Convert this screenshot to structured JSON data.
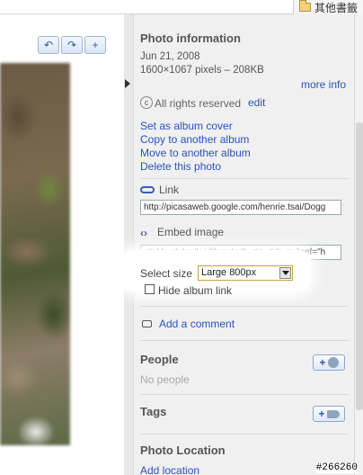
{
  "browser": {
    "bookmark_folder": "其他書籤"
  },
  "toolbar": {
    "rotate_left": "↶",
    "rotate_right": "↷",
    "zoom": "+"
  },
  "photo_info": {
    "title": "Photo information",
    "date": "Jun 21, 2008",
    "dimensions": "1600×1067 pixels – 208KB",
    "more_info": "more info",
    "rights": "All rights reserved",
    "edit": "edit"
  },
  "actions": {
    "set_cover": "Set as album cover",
    "copy": "Copy to another album",
    "move": "Move to another album",
    "delete": "Delete this photo"
  },
  "link": {
    "label": "Link",
    "url": "http://picasaweb.google.com/henrie.tsai/Dogg"
  },
  "embed": {
    "label": "Embed image",
    "code": "<table style=\"width:auto;\"><tr><td><a href=\"h",
    "select_label": "Select size",
    "select_value": "Large 800px",
    "hide_album_link": "Hide album link"
  },
  "comments": {
    "add": "Add a comment"
  },
  "people": {
    "title": "People",
    "empty": "No people",
    "add_button": "+"
  },
  "tags": {
    "title": "Tags",
    "add_button": "+"
  },
  "location": {
    "title": "Photo Location",
    "add": "Add location"
  },
  "watermark": "#266260"
}
